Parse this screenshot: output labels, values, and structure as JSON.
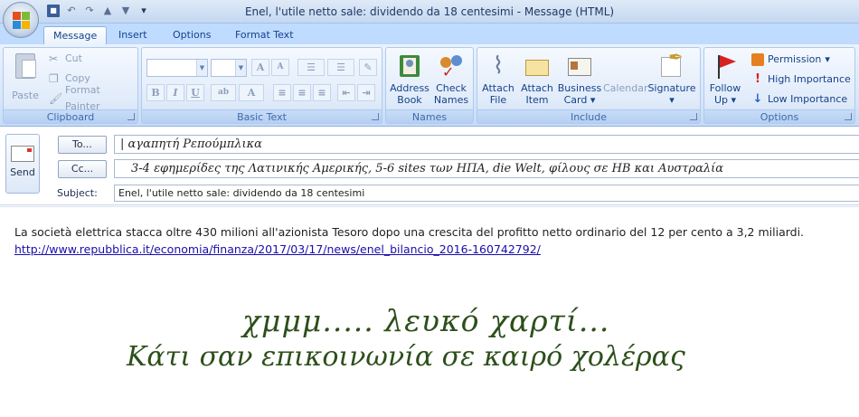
{
  "window": {
    "title": "Enel, l'utile netto sale: dividendo da 18 centesimi - Message (HTML)"
  },
  "tabs": [
    "Message",
    "Insert",
    "Options",
    "Format Text"
  ],
  "ribbon": {
    "clipboard": {
      "label": "Clipboard",
      "paste": "Paste",
      "cut": "Cut",
      "copy": "Copy",
      "format_painter": "Format Painter"
    },
    "basic_text": {
      "label": "Basic Text"
    },
    "names": {
      "label": "Names",
      "address_book_1": "Address",
      "address_book_2": "Book",
      "check_names_1": "Check",
      "check_names_2": "Names"
    },
    "include": {
      "label": "Include",
      "attach_file_1": "Attach",
      "attach_file_2": "File",
      "attach_item_1": "Attach",
      "attach_item_2": "Item",
      "business_card_1": "Business",
      "business_card_2": "Card",
      "calendar": "Calendar",
      "signature": "Signature"
    },
    "options": {
      "label": "Options",
      "follow_up_1": "Follow",
      "follow_up_2": "Up",
      "permission": "Permission",
      "high_importance": "High Importance",
      "low_importance": "Low Importance"
    }
  },
  "header": {
    "send": "Send",
    "to_button": "To...",
    "cc_button": "Cc...",
    "subject_label": "Subject:",
    "to_value": "αγαπητή Ρεπούμπλικα",
    "cc_value": "3-4 εφημερίδες της Λατινικής Αμερικής, 5-6 sites των ΗΠΑ, die Welt, φίλους σε ΗΒ και Αυστραλία",
    "subject_value": "Enel, l'utile netto sale: dividendo da 18 centesimi"
  },
  "body": {
    "text": "La società elettrica stacca oltre 430 milioni all'azionista Tesoro dopo una crescita del profitto netto ordinario del 12 per cento a 3,2 miliardi.",
    "link": "http://www.repubblica.it/economia/finanza/2017/03/17/news/enel_bilancio_2016-160742792/",
    "handwriting_1": "χμμμ..... λευκό χαρτί...",
    "handwriting_2": "Κάτι σαν επικοινωνία σε καιρό χολέρας"
  },
  "colors": {
    "ribbon_blue": "#bfdbff",
    "group_label": "#3e6aaa",
    "handwriting_green": "#2d4f1b",
    "link_blue": "#1a0dab"
  }
}
